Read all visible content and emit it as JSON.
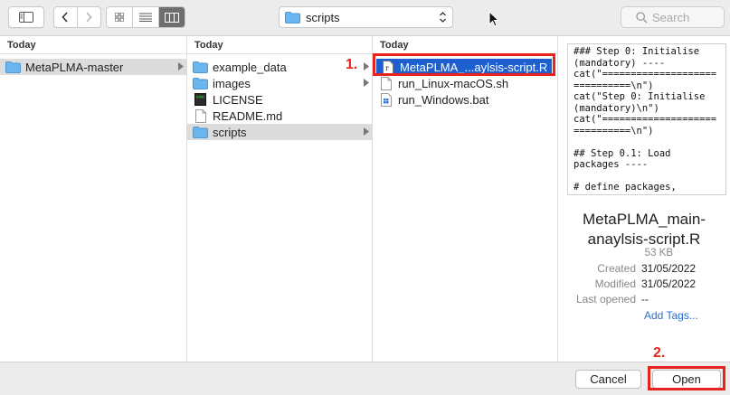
{
  "toolbar": {
    "path_label": "scripts",
    "search_placeholder": "Search"
  },
  "columns": [
    {
      "header": "Today",
      "items": [
        {
          "label": "MetaPLMA-master",
          "icon": "folder-icon",
          "has_children": true,
          "state": "selected-inactive"
        }
      ]
    },
    {
      "header": "Today",
      "items": [
        {
          "label": "example_data",
          "icon": "folder-icon",
          "has_children": true,
          "state": "normal"
        },
        {
          "label": "images",
          "icon": "folder-icon",
          "has_children": true,
          "state": "normal"
        },
        {
          "label": "LICENSE",
          "icon": "terminal-file-icon",
          "has_children": false,
          "state": "normal"
        },
        {
          "label": "README.md",
          "icon": "text-file-icon",
          "has_children": false,
          "state": "normal"
        },
        {
          "label": "scripts",
          "icon": "folder-icon",
          "has_children": true,
          "state": "selected-inactive"
        }
      ]
    },
    {
      "header": "Today",
      "items": [
        {
          "label": "MetaPLMA_...aylsis-script.R",
          "icon": "r-script-file-icon",
          "has_children": false,
          "state": "selected-active"
        },
        {
          "label": "run_Linux-macOS.sh",
          "icon": "text-file-icon",
          "has_children": false,
          "state": "normal"
        },
        {
          "label": "run_Windows.bat",
          "icon": "windows-file-icon",
          "has_children": false,
          "state": "normal"
        }
      ]
    }
  ],
  "preview": {
    "code": "### Step 0: Initialise\n(mandatory) ----\ncat(\"====================\n==========\\n\")\ncat(\"Step 0: Initialise\n(mandatory)\\n\")\ncat(\"====================\n==========\\n\")\n\n## Step 0.1: Load\npackages ----\n\n# define packages,",
    "filename_line1": "MetaPLMA_main-",
    "filename_line2": "anaylsis-script.R",
    "size": "53 KB",
    "created_label": "Created",
    "created_value": "31/05/2022",
    "modified_label": "Modified",
    "modified_value": "31/05/2022",
    "last_opened_label": "Last opened",
    "last_opened_value": "--",
    "add_tags": "Add Tags..."
  },
  "buttons": {
    "cancel": "Cancel",
    "open": "Open"
  },
  "annotations": {
    "step1": "1.",
    "step2": "2."
  },
  "colors": {
    "selection_blue": "#1e5fd0",
    "annotation_red": "#e8231d",
    "folder_blue": "#6cb6f0"
  }
}
